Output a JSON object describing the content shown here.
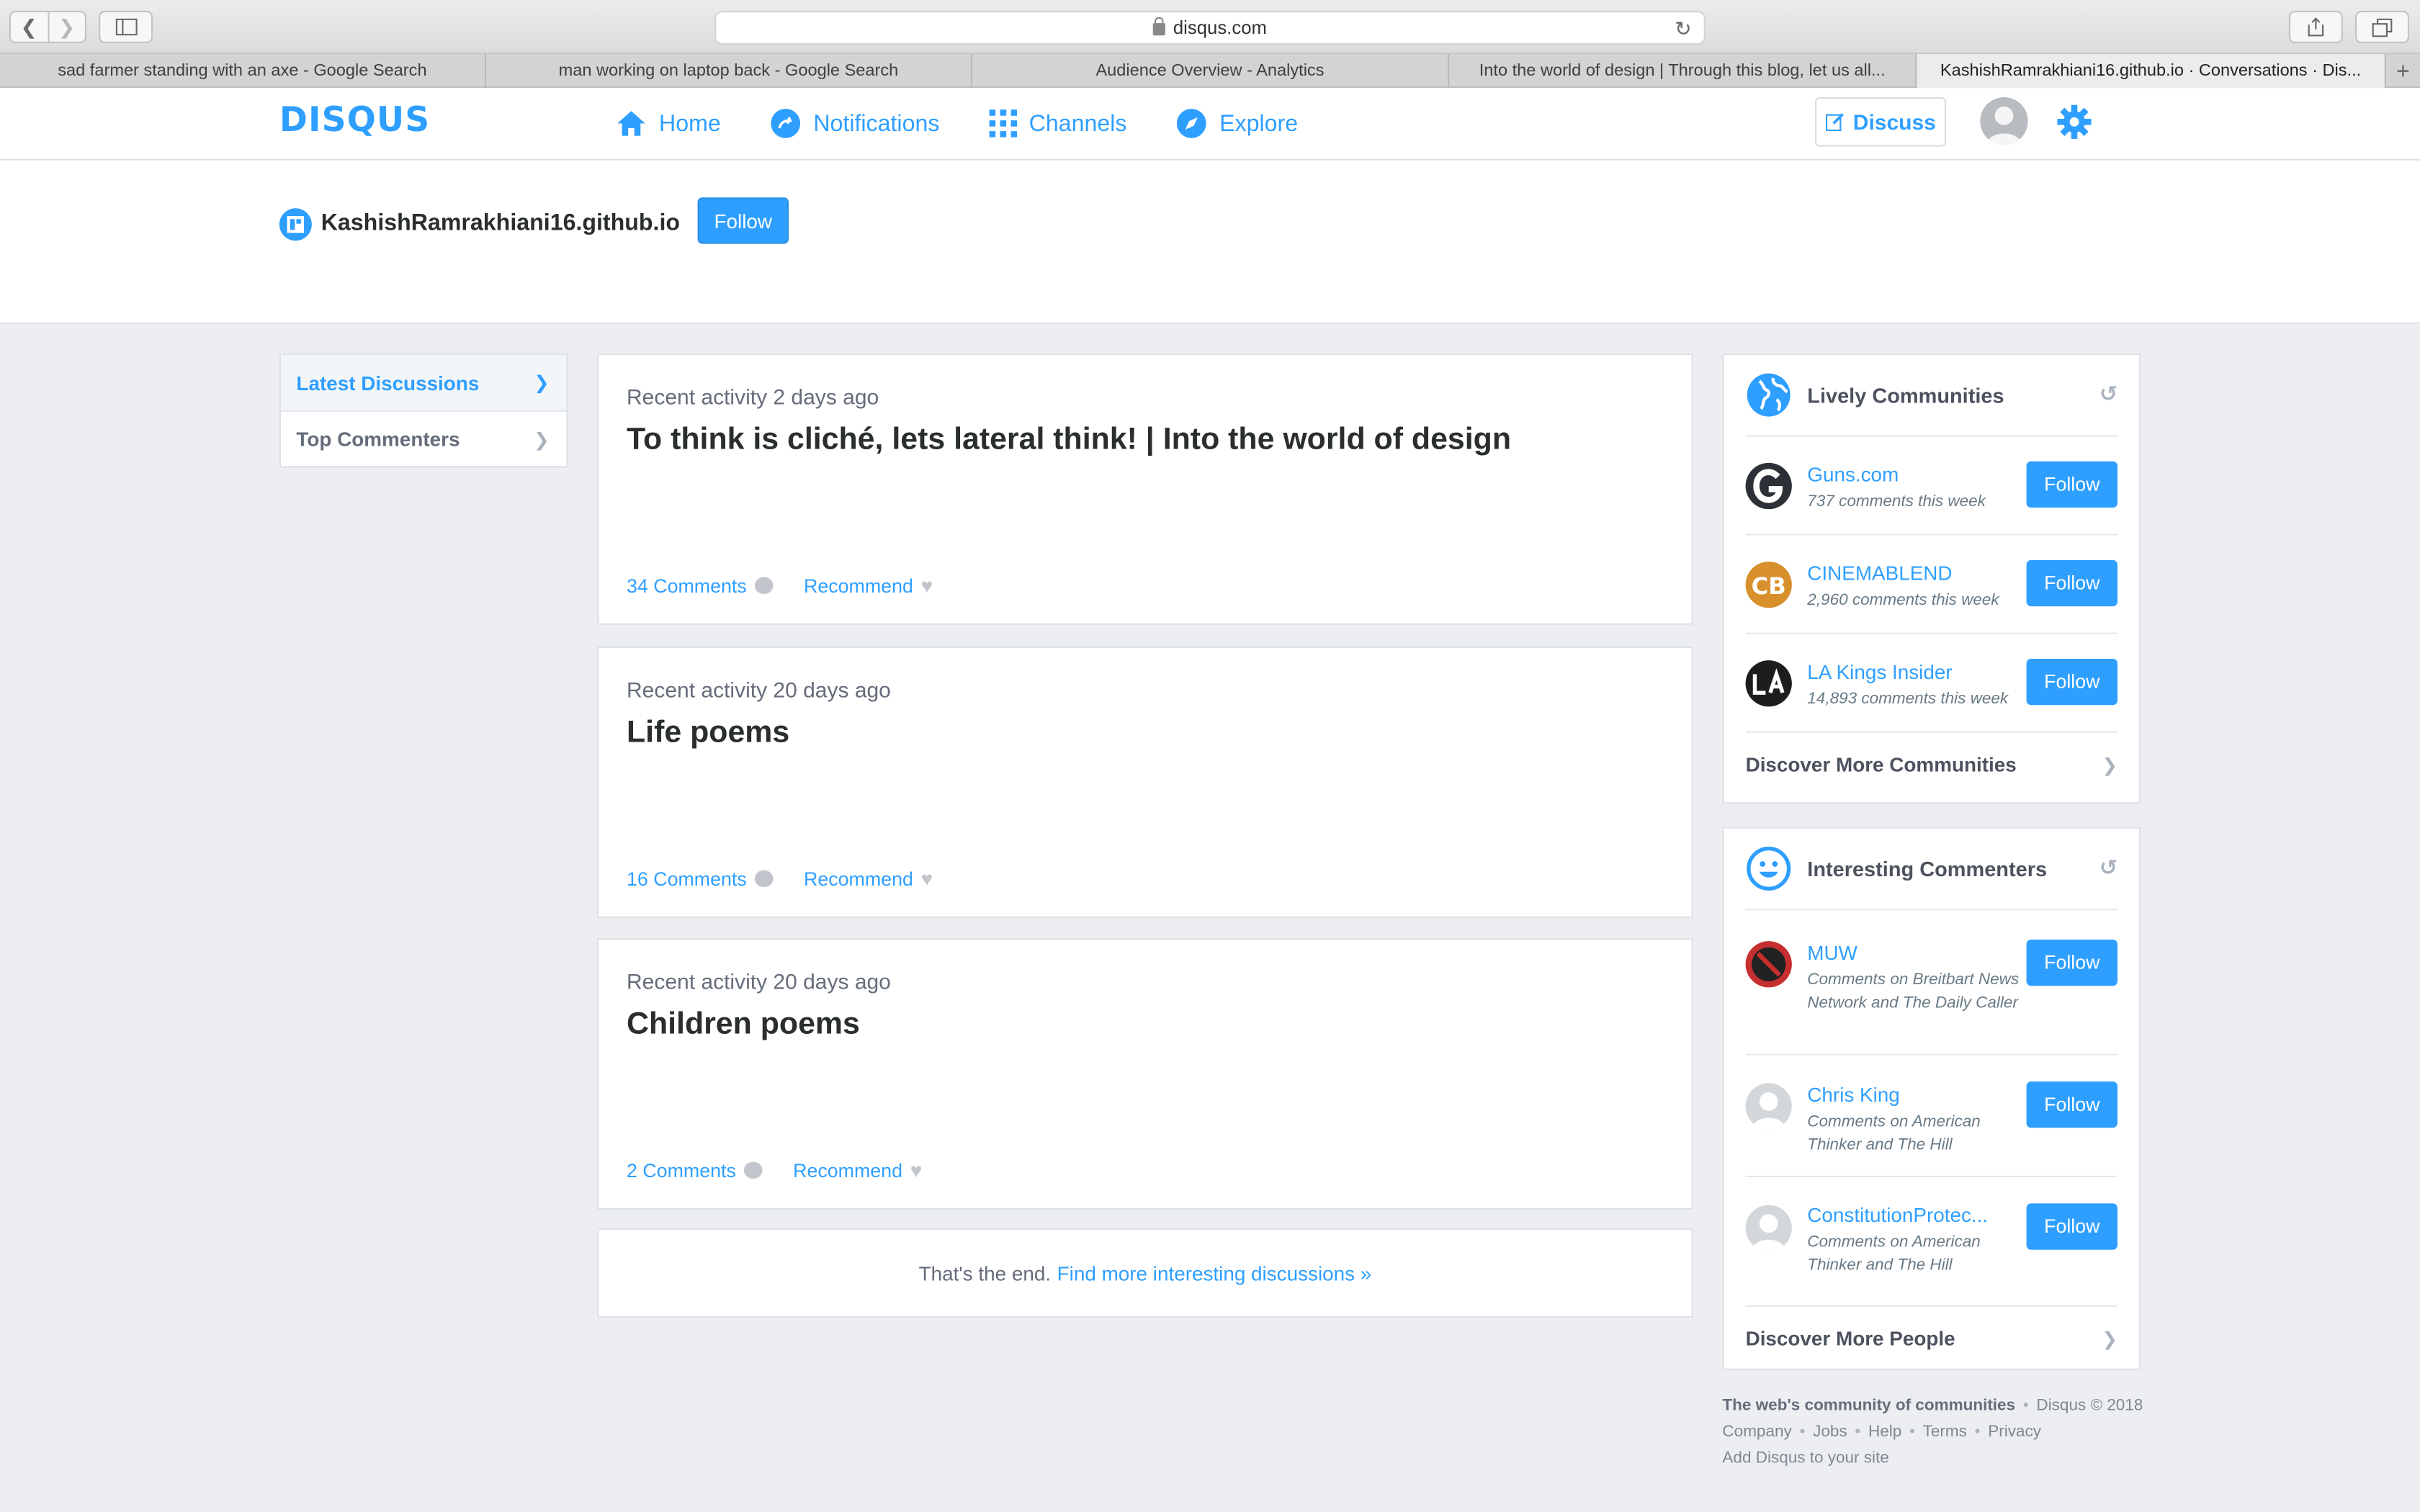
{
  "browser": {
    "url": "disqus.com",
    "tabs": [
      {
        "title": "sad farmer standing with an axe - Google Search"
      },
      {
        "title": "man working on laptop back - Google Search"
      },
      {
        "title": "Audience Overview - Analytics"
      },
      {
        "title": "Into the world of design | Through this blog, let us all..."
      },
      {
        "title": "KashishRamrakhiani16.github.io · Conversations · Dis..."
      }
    ]
  },
  "header": {
    "logo": "DISQUS",
    "nav": [
      {
        "label": "Home",
        "icon": "home-icon"
      },
      {
        "label": "Notifications",
        "icon": "notifications-icon"
      },
      {
        "label": "Channels",
        "icon": "channels-icon"
      },
      {
        "label": "Explore",
        "icon": "explore-icon"
      }
    ],
    "discuss_label": "Discuss"
  },
  "site": {
    "name": "KashishRamrakhiani16.github.io",
    "follow_label": "Follow"
  },
  "sidebar": {
    "items": [
      {
        "label": "Latest Discussions",
        "active": true
      },
      {
        "label": "Top Commenters",
        "active": false
      }
    ]
  },
  "discussions": [
    {
      "activity": "Recent activity 2 days ago",
      "title": "To think is cliché, lets lateral think! | Into the world of design",
      "comments": "34 Comments",
      "recommend": "Recommend"
    },
    {
      "activity": "Recent activity 20 days ago",
      "title": "Life poems",
      "comments": "16 Comments",
      "recommend": "Recommend"
    },
    {
      "activity": "Recent activity 20 days ago",
      "title": "Children poems",
      "comments": "2 Comments",
      "recommend": "Recommend"
    }
  ],
  "end": {
    "text": "That's the end.",
    "link": "Find more interesting discussions »"
  },
  "communities": {
    "title": "Lively Communities",
    "items": [
      {
        "name": "Guns.com",
        "sub": "737 comments this week",
        "follow": "Follow"
      },
      {
        "name": "CINEMABLEND",
        "sub": "2,960 comments this week",
        "follow": "Follow"
      },
      {
        "name": "LA Kings Insider",
        "sub": "14,893 comments this week",
        "follow": "Follow"
      }
    ],
    "discover": "Discover More Communities"
  },
  "commenters": {
    "title": "Interesting Commenters",
    "items": [
      {
        "name": "MUW",
        "sub": "Comments on Breitbart News Network and The Daily Caller",
        "follow": "Follow"
      },
      {
        "name": "Chris King",
        "sub": "Comments on American Thinker and The Hill",
        "follow": "Follow"
      },
      {
        "name": "ConstitutionProtec...",
        "sub": "Comments on American Thinker and The Hill",
        "follow": "Follow"
      }
    ],
    "discover": "Discover More People"
  },
  "footer": {
    "tagline": "The web's community of communities",
    "copyright": "Disqus © 2018",
    "links": [
      "Company",
      "Jobs",
      "Help",
      "Terms",
      "Privacy"
    ],
    "add": "Add Disqus to your site"
  },
  "colors": {
    "accent": "#2e9fff",
    "page_bg": "#eceef1"
  }
}
